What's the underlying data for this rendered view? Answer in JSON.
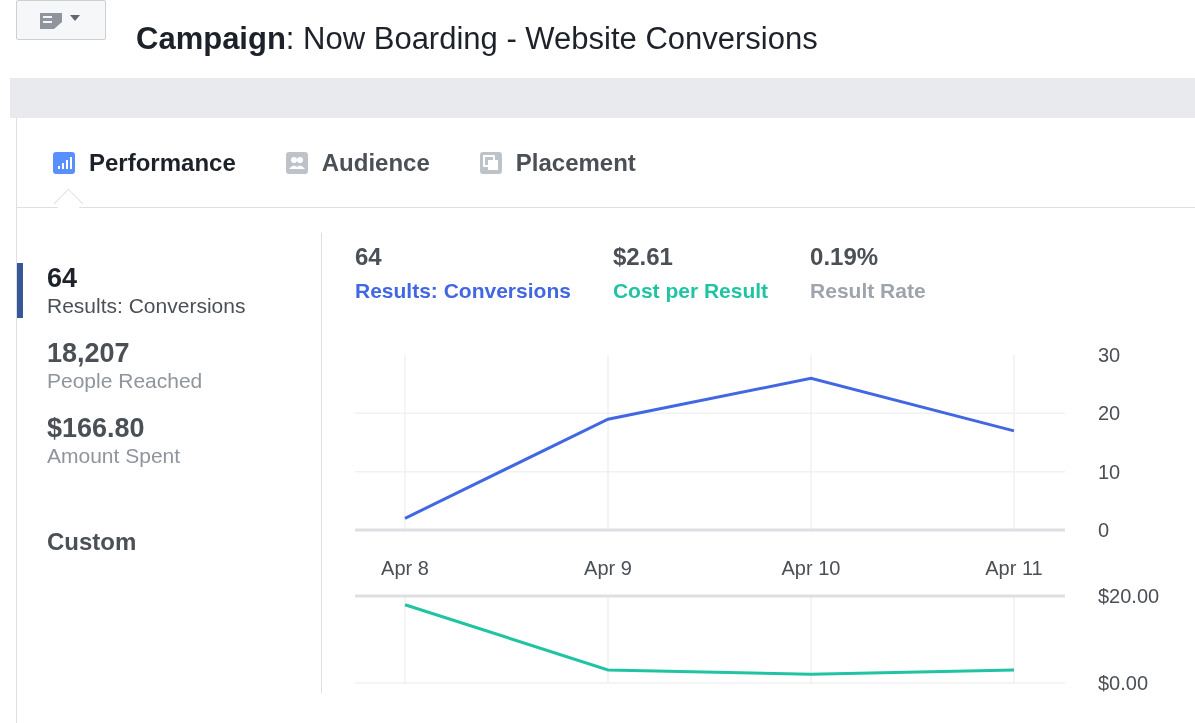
{
  "header": {
    "title_label": "Campaign",
    "title_rest": ": Now Boarding - Website Conversions"
  },
  "tabs": [
    {
      "label": "Performance",
      "selected": true
    },
    {
      "label": "Audience",
      "selected": false
    },
    {
      "label": "Placement",
      "selected": false
    }
  ],
  "summary": [
    {
      "value": "64",
      "label": "Results: Conversions",
      "selected": true
    },
    {
      "value": "18,207",
      "label": "People Reached",
      "selected": false
    },
    {
      "value": "$166.80",
      "label": "Amount Spent",
      "selected": false
    }
  ],
  "custom_label": "Custom",
  "legend": [
    {
      "value": "64",
      "label": "Results: Conversions",
      "color": "#4267e2"
    },
    {
      "value": "$2.61",
      "label": "Cost per Result",
      "color": "#20c4a2"
    },
    {
      "value": "0.19%",
      "label": "Result Rate",
      "color": "#9ea3ac"
    }
  ],
  "charts": [
    {
      "chart_data": {
        "type": "line",
        "categories": [
          "Apr 8",
          "Apr 9",
          "Apr 10",
          "Apr 11"
        ],
        "ylim": [
          0,
          30
        ],
        "yticks": [
          0,
          10,
          20,
          30
        ],
        "grid": true,
        "series": [
          {
            "color": "#4267e2",
            "values": [
              2,
              19,
              26,
              17
            ]
          }
        ]
      }
    },
    {
      "chart_data": {
        "type": "line",
        "ylim": [
          0,
          20
        ],
        "yticks": [
          {
            "value": 0,
            "label": "$0.00"
          },
          {
            "value": 20,
            "label": "$20.00"
          }
        ],
        "grid": true,
        "series": [
          {
            "color": "#20c4a2",
            "values": [
              18,
              3,
              2,
              3
            ]
          }
        ]
      }
    }
  ]
}
